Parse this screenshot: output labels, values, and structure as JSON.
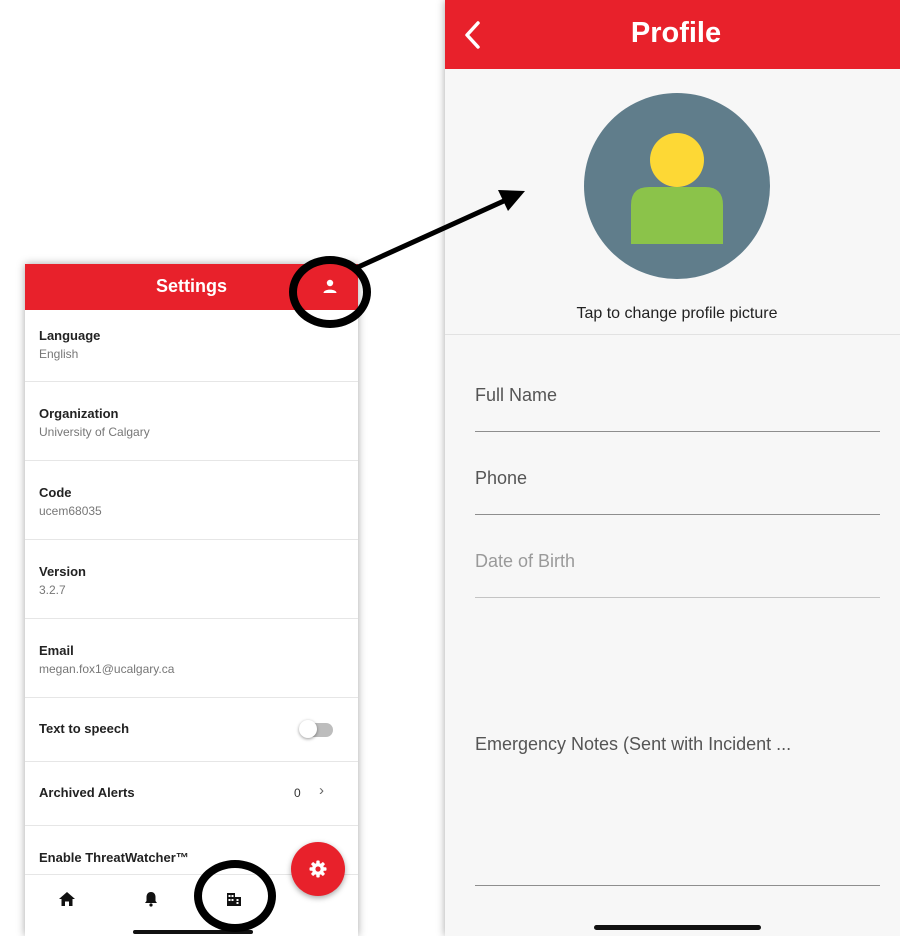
{
  "settings": {
    "title": "Settings",
    "rows": [
      {
        "label": "Language",
        "value": "English"
      },
      {
        "label": "Organization",
        "value": "University of Calgary"
      },
      {
        "label": "Code",
        "value": "ucem68035"
      },
      {
        "label": "Version",
        "value": "3.2.7"
      },
      {
        "label": "Email",
        "value": "megan.fox1@ucalgary.ca"
      }
    ],
    "text_to_speech": {
      "label": "Text to speech",
      "enabled": false
    },
    "archived_alerts": {
      "label": "Archived Alerts",
      "count": "0",
      "chevron": "›"
    },
    "threatwatcher": {
      "label": "Enable ThreatWatcher™"
    },
    "nav_icons": [
      "home-icon",
      "bell-icon",
      "building-icon"
    ],
    "fab_icon": "gear-icon",
    "profile_icon": "user-icon"
  },
  "profile": {
    "title": "Profile",
    "back_icon": "back-chevron-icon",
    "avatar_icon": "default-avatar",
    "tap_text": "Tap to change profile picture",
    "fields": {
      "full_name": "Full Name",
      "phone": "Phone",
      "date_of_birth": "Date of Birth",
      "emergency_notes": "Emergency Notes (Sent with Incident ..."
    }
  },
  "colors": {
    "brand_red": "#e8212b",
    "avatar_bg": "#607d8b",
    "avatar_head": "#fdd835",
    "avatar_body": "#8bc34a"
  }
}
